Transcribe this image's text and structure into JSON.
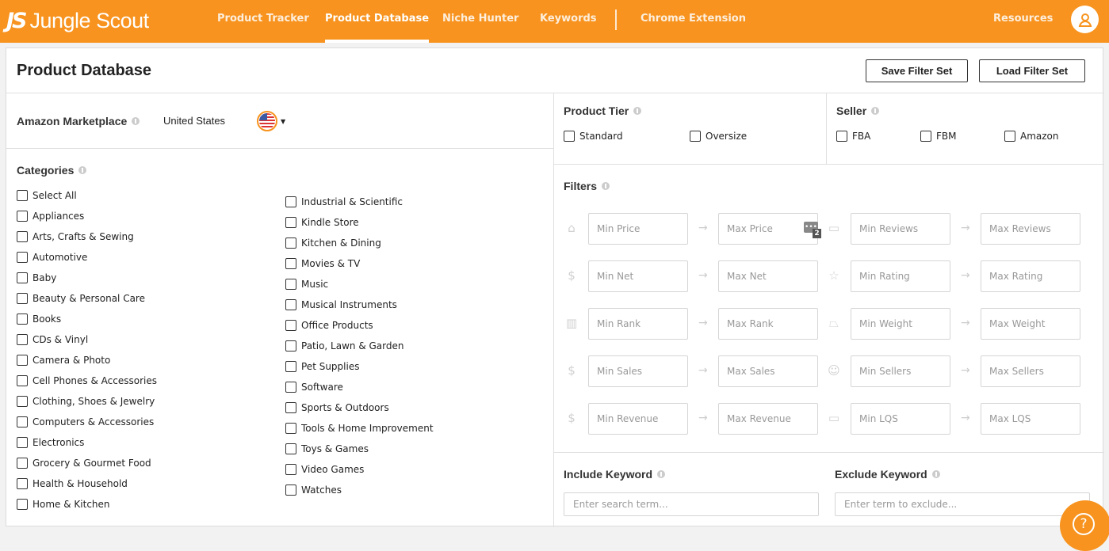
{
  "nav": {
    "logo_mark": "JS",
    "logo_name": "Jungle Scout",
    "links": [
      "Product Tracker",
      "Product Database",
      "Niche Hunter",
      "Keywords",
      "Chrome Extension"
    ],
    "resources": "Resources",
    "accent": "#f7931e"
  },
  "page": {
    "title": "Product Database",
    "save_filter": "Save Filter Set",
    "load_filter": "Load Filter Set"
  },
  "marketplace": {
    "label": "Amazon Marketplace",
    "value": "United States",
    "flag_icon": "us-flag-icon"
  },
  "categories": {
    "label": "Categories",
    "col1": [
      "Select All",
      "Appliances",
      "Arts, Crafts & Sewing",
      "Automotive",
      "Baby",
      "Beauty & Personal Care",
      "Books",
      "CDs & Vinyl",
      "Camera & Photo",
      "Cell Phones & Accessories",
      "Clothing, Shoes & Jewelry",
      "Computers & Accessories",
      "Electronics",
      "Grocery & Gourmet Food",
      "Health & Household",
      "Home & Kitchen"
    ],
    "col2": [
      "Industrial & Scientific",
      "Kindle Store",
      "Kitchen & Dining",
      "Movies & TV",
      "Music",
      "Musical Instruments",
      "Office Products",
      "Patio, Lawn & Garden",
      "Pet Supplies",
      "Software",
      "Sports & Outdoors",
      "Tools & Home Improvement",
      "Toys & Games",
      "Video Games",
      "Watches"
    ]
  },
  "tier": {
    "label": "Product Tier",
    "options": [
      "Standard",
      "Oversize"
    ]
  },
  "seller": {
    "label": "Seller",
    "options": [
      "FBA",
      "FBM",
      "Amazon"
    ]
  },
  "filters": {
    "label": "Filters",
    "rows": [
      {
        "l_icon": "tag-icon",
        "l_min": "Min Price",
        "l_max": "Max Price",
        "r_icon": "comment-icon",
        "r_min": "Min Reviews",
        "r_max": "Max Reviews"
      },
      {
        "l_icon": "money-bag-icon",
        "l_min": "Min Net",
        "l_max": "Max Net",
        "r_icon": "star-icon",
        "r_min": "Min Rating",
        "r_max": "Max Rating"
      },
      {
        "l_icon": "bar-chart-icon",
        "l_min": "Min Rank",
        "l_max": "Max Rank",
        "r_icon": "weight-icon",
        "r_min": "Min Weight",
        "r_max": "Max Weight"
      },
      {
        "l_icon": "dollar-icon",
        "l_min": "Min Sales",
        "l_max": "Max Sales",
        "r_icon": "users-icon",
        "r_min": "Min Sellers",
        "r_max": "Max Sellers"
      },
      {
        "l_icon": "revenue-icon",
        "l_min": "Min Revenue",
        "l_max": "Max Revenue",
        "r_icon": "lqs-icon",
        "r_min": "Min LQS",
        "r_max": "Max LQS"
      }
    ],
    "badge_count": "2"
  },
  "keywords": {
    "include_label": "Include Keyword",
    "include_placeholder": "Enter search term...",
    "exclude_label": "Exclude Keyword",
    "exclude_placeholder": "Enter term to exclude..."
  }
}
